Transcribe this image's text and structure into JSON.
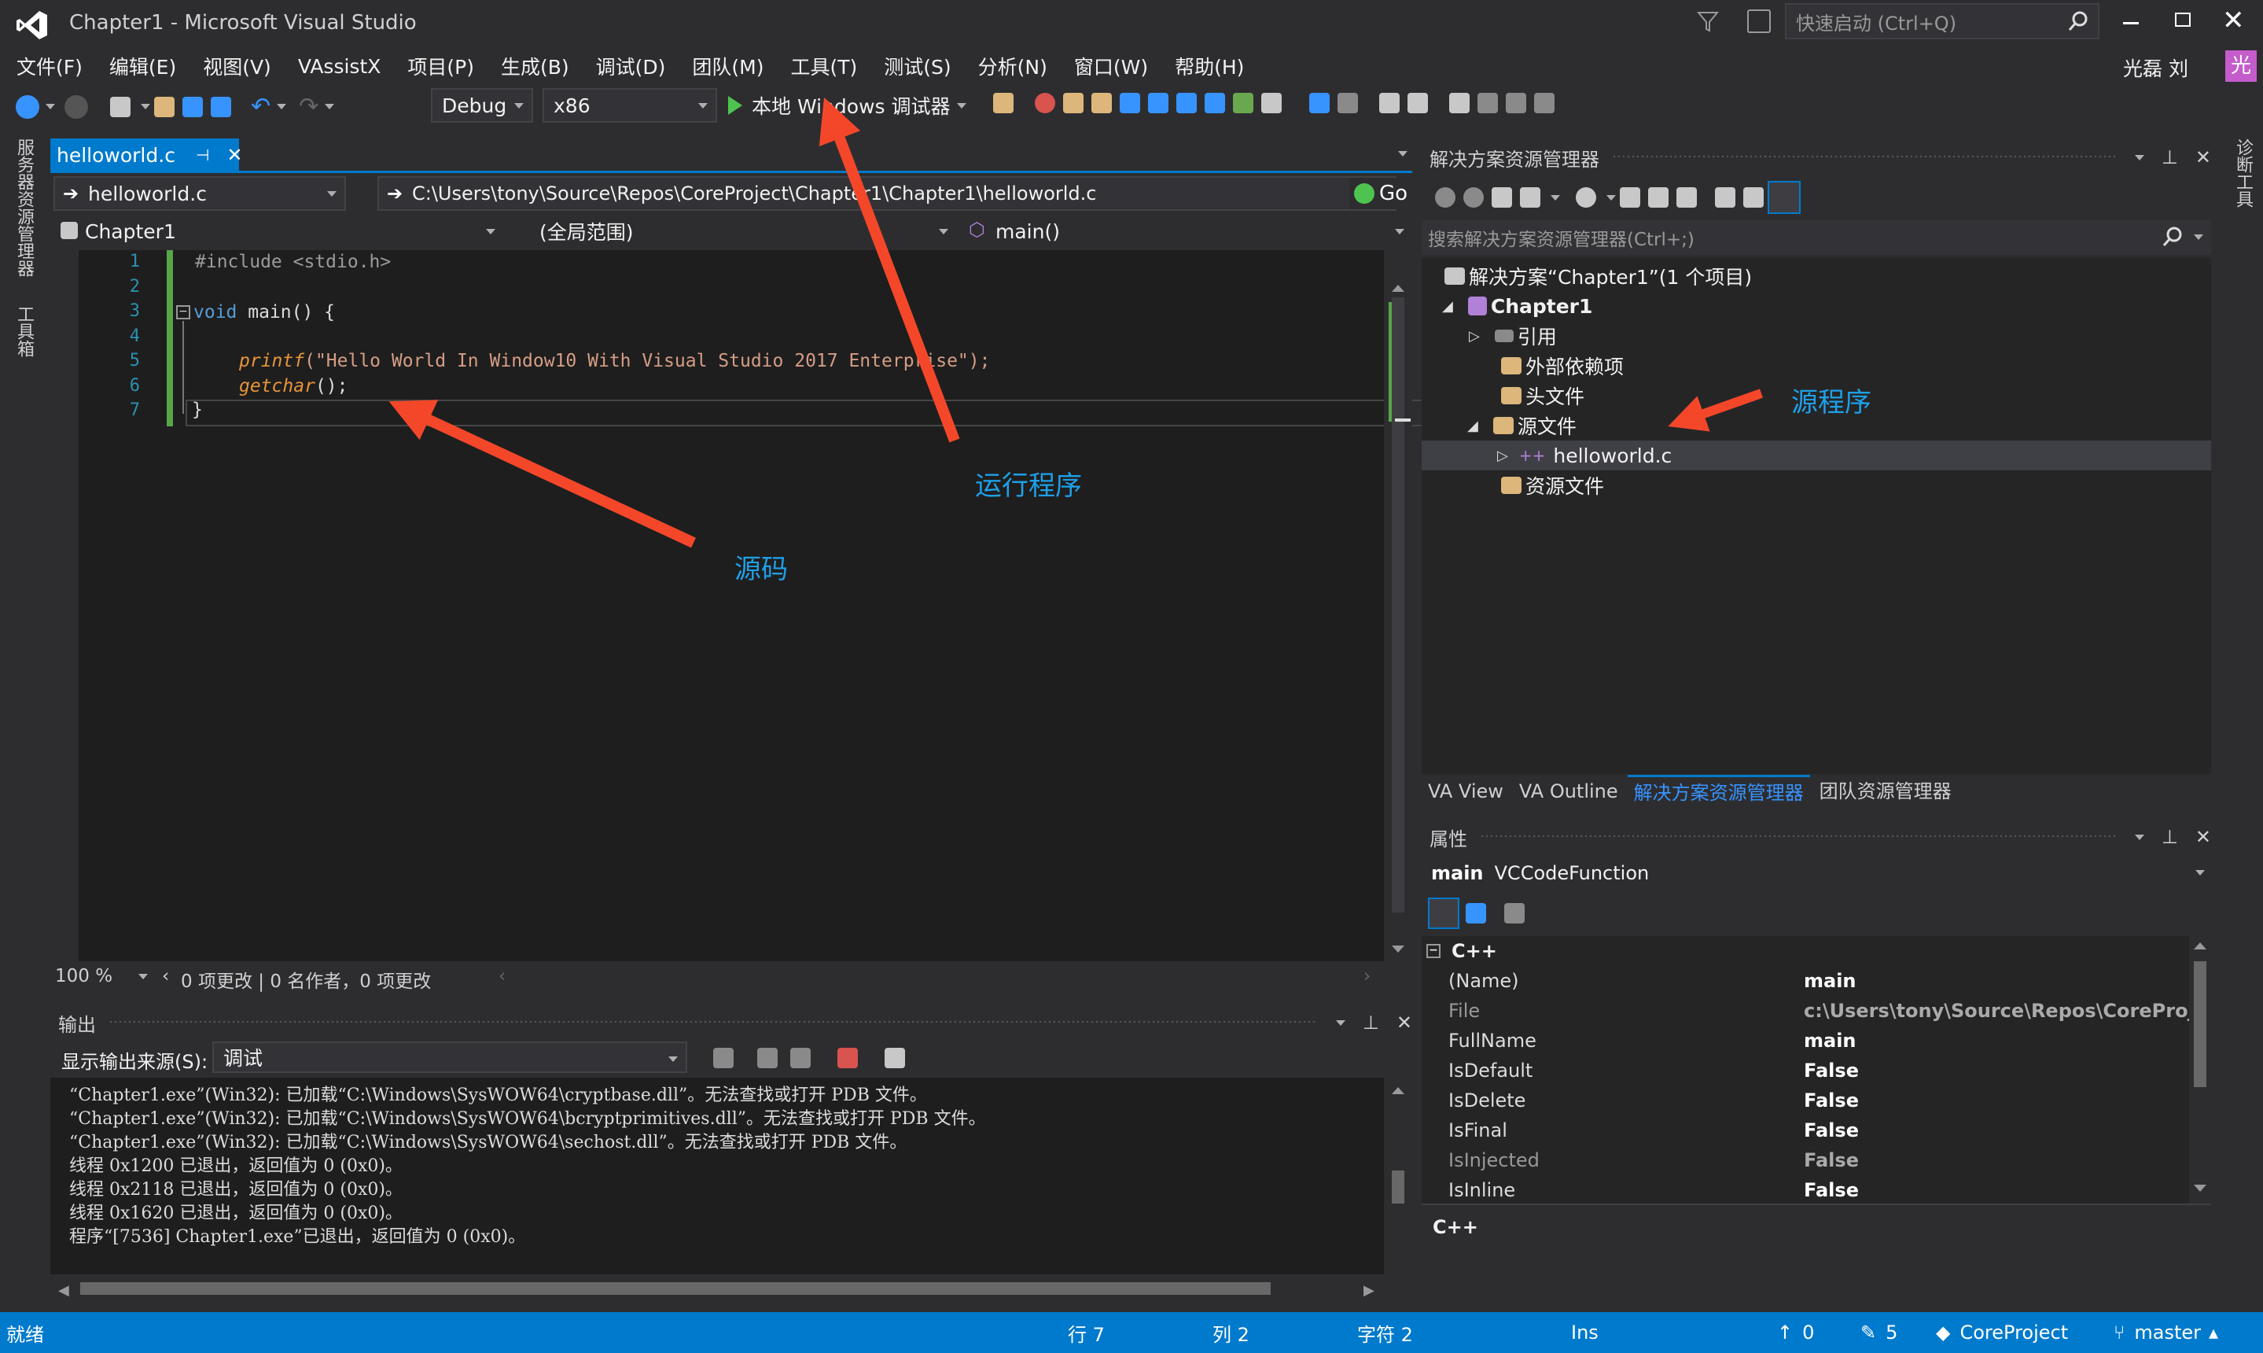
{
  "window": {
    "title": "Chapter1 - Microsoft Visual Studio",
    "quick_launch": "快速启动 (Ctrl+Q)",
    "user": "光磊 刘",
    "avatar": "光"
  },
  "menu": [
    "文件(F)",
    "编辑(E)",
    "视图(V)",
    "VAssistX",
    "项目(P)",
    "生成(B)",
    "调试(D)",
    "团队(M)",
    "工具(T)",
    "测试(S)",
    "分析(N)",
    "窗口(W)",
    "帮助(H)"
  ],
  "toolbar": {
    "config": "Debug",
    "platform": "x86",
    "run_label": "本地 Windows 调试器"
  },
  "left_strip": {
    "server_explorer": "服务器资源管理器",
    "toolbox": "工具箱"
  },
  "right_strip": {
    "diagnostic": "诊断工具"
  },
  "editor": {
    "tab": "helloworld.c",
    "file_combo": "helloworld.c",
    "path": "C:\\Users\\tony\\Source\\Repos\\CoreProject\\Chapter1\\Chapter1\\helloworld.c",
    "go": "Go",
    "project_combo": "Chapter1",
    "scope_combo": "(全局范围)",
    "member_combo": "main()",
    "line_numbers": [
      "1",
      "2",
      "3",
      "4",
      "5",
      "6",
      "7"
    ],
    "code": {
      "include": "#include <stdio.h>",
      "void_kw": "void",
      "main_sig": " main() {",
      "printf_fn": "printf",
      "printf_args": "(\"Hello World In Window10 With Visual Studio 2017 Enterprise\");",
      "getchar_fn": "getchar",
      "getchar_args": "();",
      "close": "}"
    },
    "zoom": "100 %",
    "changes": "0 项更改 | 0 名作者，0 项更改"
  },
  "output": {
    "title": "输出",
    "source_label": "显示输出来源(S):",
    "source_value": "调试",
    "lines": [
      "“Chapter1.exe”(Win32): 已加载“C:\\Windows\\SysWOW64\\cryptbase.dll”。无法查找或打开 PDB 文件。",
      "“Chapter1.exe”(Win32): 已加载“C:\\Windows\\SysWOW64\\bcryptprimitives.dll”。无法查找或打开 PDB 文件。",
      "“Chapter1.exe”(Win32): 已加载“C:\\Windows\\SysWOW64\\sechost.dll”。无法查找或打开 PDB 文件。",
      "线程 0x1200 已退出，返回值为 0 (0x0)。",
      "线程 0x2118 已退出，返回值为 0 (0x0)。",
      "线程 0x1620 已退出，返回值为 0 (0x0)。",
      "程序“[7536] Chapter1.exe”已退出，返回值为 0 (0x0)。"
    ]
  },
  "solution_explorer": {
    "title": "解决方案资源管理器",
    "search": "搜索解决方案资源管理器(Ctrl+;)",
    "solution": "解决方案“Chapter1”(1 个项目)",
    "project": "Chapter1",
    "references": "引用",
    "external": "外部依赖项",
    "headers": "头文件",
    "sources": "源文件",
    "file": "helloworld.c",
    "resources": "资源文件",
    "bottom_tabs": [
      "VA View",
      "VA Outline",
      "解决方案资源管理器",
      "团队资源管理器"
    ]
  },
  "properties": {
    "title": "属性",
    "object_name": "main",
    "object_type": "VCCodeFunction",
    "category": "C++",
    "rows": [
      {
        "name": "(Name)",
        "value": "main"
      },
      {
        "name": "File",
        "value": "c:\\Users\\tony\\Source\\Repos\\CoreProje"
      },
      {
        "name": "FullName",
        "value": "main"
      },
      {
        "name": "IsDefault",
        "value": "False"
      },
      {
        "name": "IsDelete",
        "value": "False"
      },
      {
        "name": "IsFinal",
        "value": "False"
      },
      {
        "name": "IsInjected",
        "value": "False"
      },
      {
        "name": "IsInline",
        "value": "False"
      }
    ],
    "description": "C++"
  },
  "annotations": {
    "source": "源码",
    "run": "运行程序",
    "program": "源程序"
  },
  "status": {
    "ready": "就绪",
    "line": "行 7",
    "col": "列 2",
    "char": "字符 2",
    "ins": "Ins",
    "up": "0",
    "edits": "5",
    "repo": "CoreProject",
    "branch": "master"
  },
  "colors": {
    "accent": "#007acc",
    "arrow": "#f4472a",
    "annotation": "#1ea0e8"
  }
}
